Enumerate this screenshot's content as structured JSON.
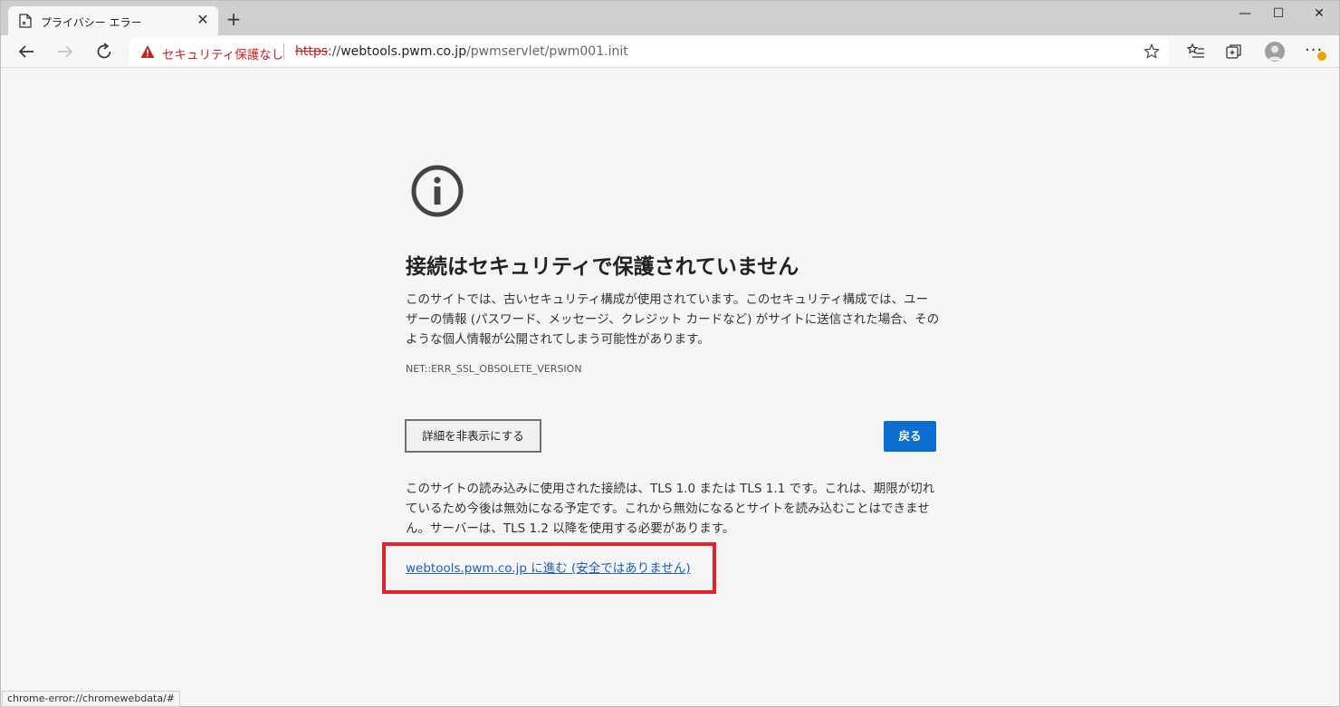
{
  "tab": {
    "title": "プライバシー エラー",
    "close_glyph": "✕",
    "new_tab_glyph": "+"
  },
  "window": {
    "minimize_glyph": "—",
    "maximize_glyph": "☐",
    "close_glyph": "✕"
  },
  "address_bar": {
    "security_text": "セキュリティ保護なし",
    "url_scheme": "https",
    "url_sep": "://",
    "url_host": "webtools.pwm.co.jp",
    "url_path": "/pwmservlet/pwm001.init"
  },
  "toolbar": {
    "more_glyph": "···"
  },
  "page": {
    "heading": "接続はセキュリティで保護されていません",
    "description": "このサイトでは、古いセキュリティ構成が使用されています。このセキュリティ構成では、ユーザーの情報 (パスワード、メッセージ、クレジット カードなど) がサイトに送信された場合、そのような個人情報が公開されてしまう可能性があります。",
    "error_code": "NET::ERR_SSL_OBSOLETE_VERSION",
    "hide_details_label": "詳細を非表示にする",
    "back_label": "戻る",
    "explanation": "このサイトの読み込みに使用された接続は、TLS 1.0 または TLS 1.1 です。これは、期限が切れているため今後は無効になる予定です。これから無効になるとサイトを読み込むことはできません。サーバーは、TLS 1.2 以降を使用する必要があります。",
    "proceed_link": "webtools.pwm.co.jp に進む (安全ではありません)"
  },
  "status_bar": {
    "text": "chrome-error://chromewebdata/#"
  },
  "colors": {
    "accent": "#0b6dd0",
    "warning": "#c5221f",
    "highlight_box": "#e2232a"
  }
}
